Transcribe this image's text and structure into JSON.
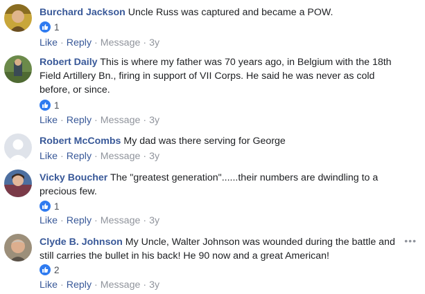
{
  "comments": [
    {
      "author": "Burchard Jackson",
      "text": "Uncle Russ was captured and became a POW.",
      "reactions": "1",
      "actions": {
        "like": "Like",
        "reply": "Reply",
        "message": "Message",
        "time": "3y"
      }
    },
    {
      "author": "Robert Daily",
      "text": "This is where my father was 70 years ago, in Belgium with the 18th Field Artillery Bn., firing in support of VII Corps. He said he was never as cold before, or since.",
      "reactions": "1",
      "actions": {
        "like": "Like",
        "reply": "Reply",
        "message": "Message",
        "time": "3y"
      }
    },
    {
      "author": "Robert McCombs",
      "text": "My dad was there serving for George",
      "actions": {
        "like": "Like",
        "reply": "Reply",
        "message": "Message",
        "time": "3y"
      }
    },
    {
      "author": "Vicky Boucher",
      "text": "The \"greatest generation\"......their numbers are dwindling to a precious few.",
      "reactions": "1",
      "actions": {
        "like": "Like",
        "reply": "Reply",
        "message": "Message",
        "time": "3y"
      }
    },
    {
      "author": "Clyde B. Johnson",
      "text": "My Uncle, Walter Johnson was wounded during the battle and still carries the bullet in his back! He 90 now and a great American!",
      "reactions": "2",
      "more": "•••",
      "actions": {
        "like": "Like",
        "reply": "Reply",
        "message": "Message",
        "time": "3y"
      }
    }
  ],
  "separator": "·",
  "colors": {
    "author": "#385898",
    "text": "#1c1e21",
    "muted": "#90949c",
    "like_badge": "#2f7bf0"
  },
  "icons": {
    "reaction": "thumbs-up-icon",
    "more": "more-options-icon"
  }
}
